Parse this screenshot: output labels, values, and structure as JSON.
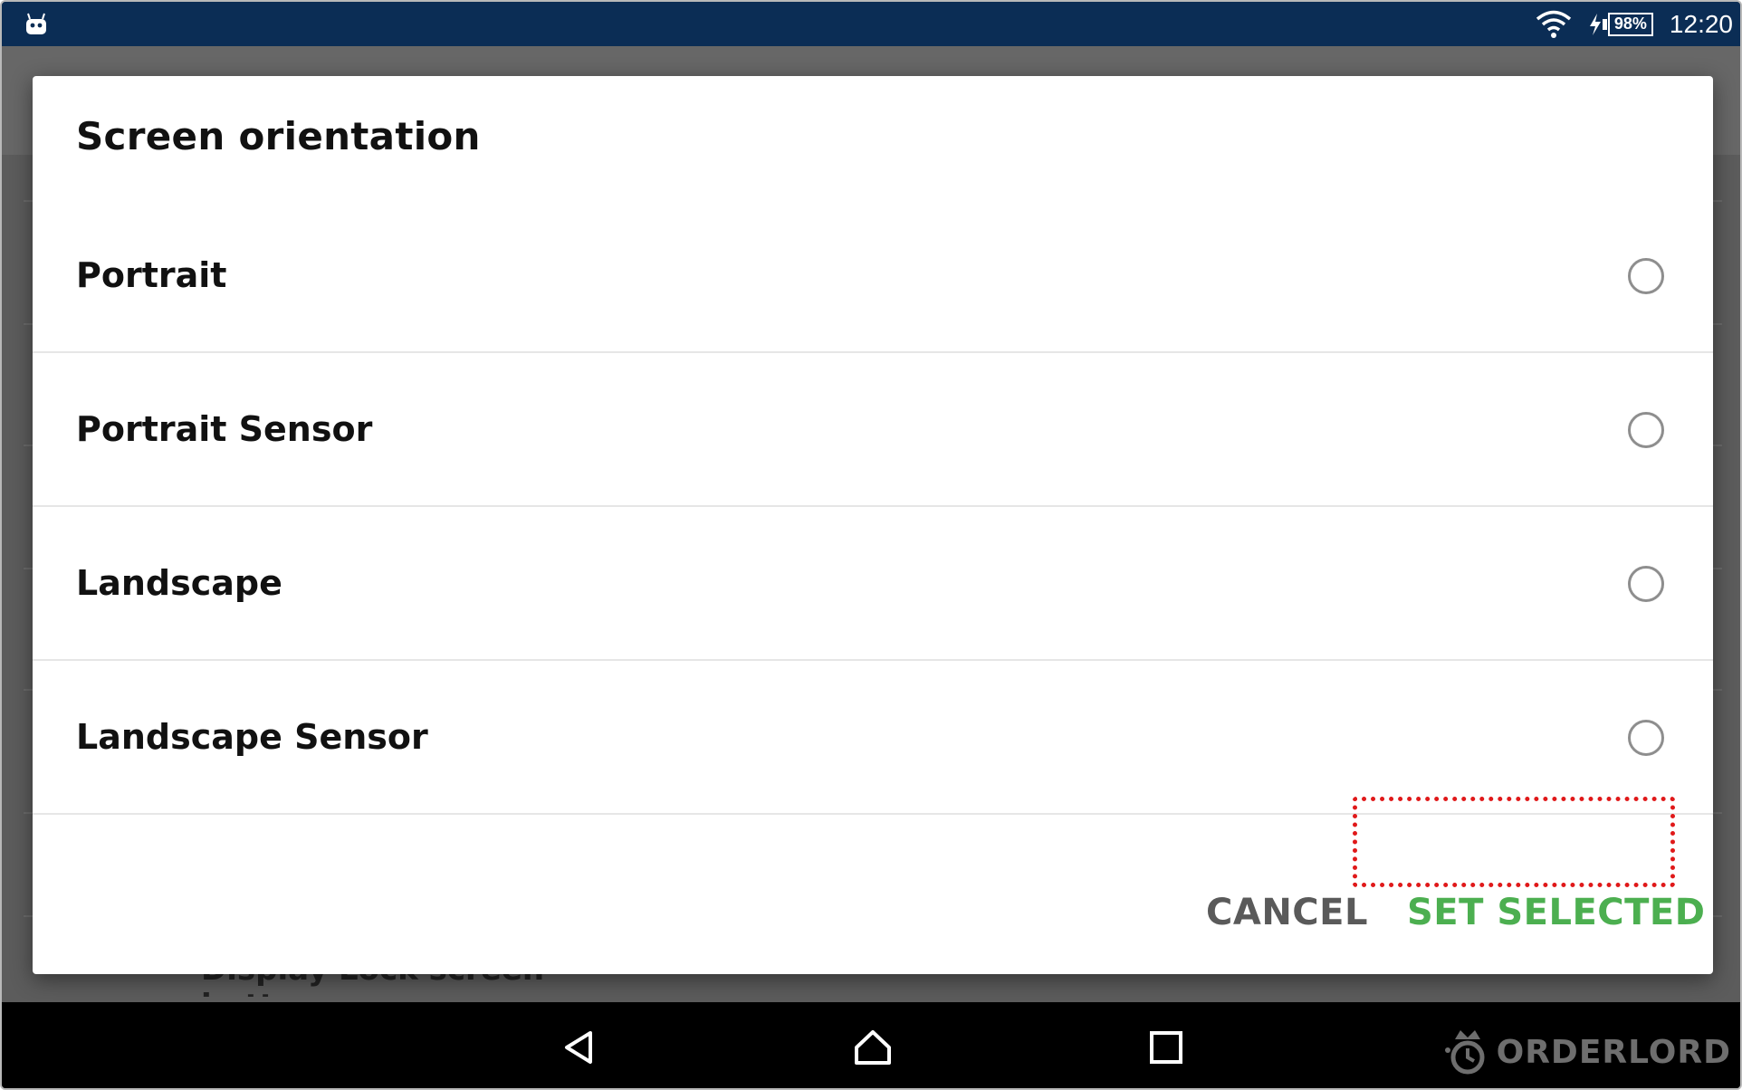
{
  "status_bar": {
    "battery_percent": "98%",
    "time": "12:20",
    "icons": [
      "android-robot-icon",
      "wifi-icon",
      "charging-bolt-icon",
      "battery-icon"
    ]
  },
  "background": {
    "partial_text": "Display Lock screen button"
  },
  "dialog": {
    "title": "Screen orientation",
    "options": [
      {
        "label": "Portrait",
        "selected": false
      },
      {
        "label": "Portrait Sensor",
        "selected": false
      },
      {
        "label": "Landscape",
        "selected": false
      },
      {
        "label": "Landscape Sensor",
        "selected": false
      }
    ],
    "cancel_label": "CANCEL",
    "set_selected_label": "SET SELECTED",
    "highlight_color": "#e0191a",
    "accent_color": "#4caf50"
  },
  "nav_bar": {
    "icons": [
      "back-icon",
      "home-icon",
      "recents-icon"
    ]
  },
  "watermark": {
    "text": "ORDERLORD"
  }
}
